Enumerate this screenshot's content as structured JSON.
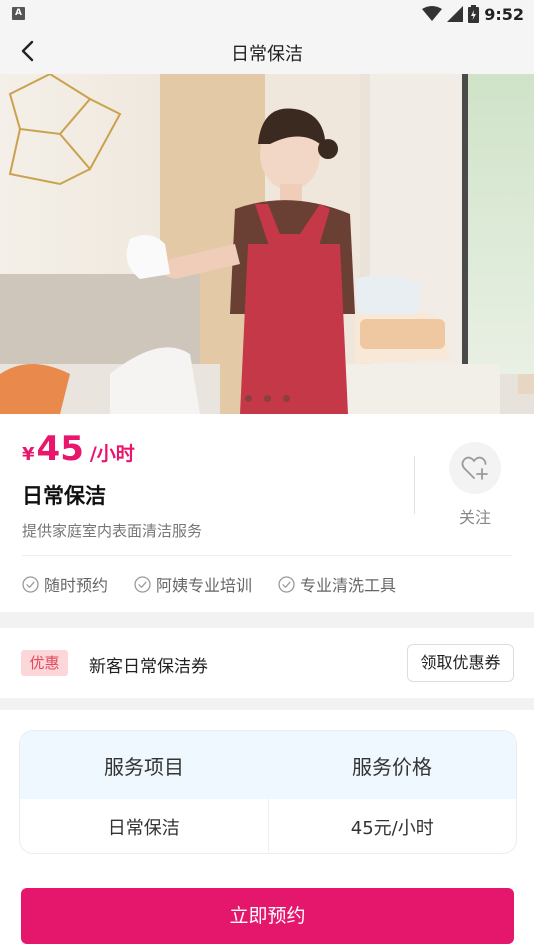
{
  "status_bar": {
    "time": "9:52",
    "left_badge": "A",
    "icons": [
      "wifi-icon",
      "cellular-signal-icon",
      "battery-icon"
    ]
  },
  "nav": {
    "title": "日常保洁",
    "back_icon": "chevron-left-icon"
  },
  "hero": {
    "slide_count": 3,
    "active_slide": 1
  },
  "product": {
    "currency": "¥",
    "price": "45",
    "price_unit": "/小时",
    "name": "日常保洁",
    "description": "提供家庭室内表面清洁服务",
    "follow_label": "关注",
    "follow_icon": "heart-plus-icon",
    "features": [
      "随时预约",
      "阿姨专业培训",
      "专业清洗工具"
    ]
  },
  "coupon": {
    "badge": "优惠",
    "title": "新客日常保洁券",
    "button": "领取优惠券"
  },
  "price_table": {
    "headers": [
      "服务项目",
      "服务价格"
    ],
    "rows": [
      [
        "日常保洁",
        "45元/小时"
      ]
    ]
  },
  "actions": {
    "book": "立即预约"
  },
  "colors": {
    "accent": "#e5176c",
    "badge_bg": "#fbd7d9",
    "badge_text": "#e34a5c",
    "table_header_bg": "#eef8fe"
  }
}
